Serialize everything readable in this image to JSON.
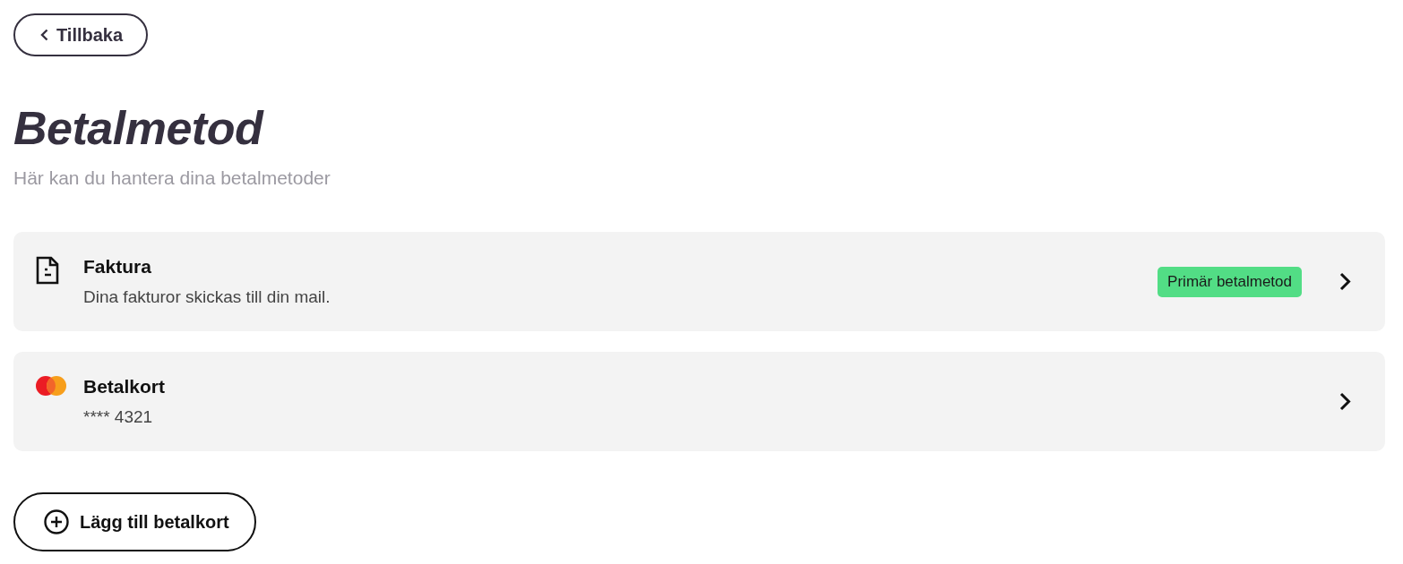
{
  "back_button": {
    "label": "Tillbaka"
  },
  "header": {
    "title": "Betalmetod",
    "subtitle": "Här kan du hantera dina betalmetoder"
  },
  "payment_methods": [
    {
      "kind": "invoice",
      "title": "Faktura",
      "detail": "Dina fakturor skickas till din mail.",
      "badge": "Primär betalmetod"
    },
    {
      "kind": "card",
      "title": "Betalkort",
      "detail": "**** 4321"
    }
  ],
  "add_button": {
    "label": "Lägg till betalkort"
  }
}
